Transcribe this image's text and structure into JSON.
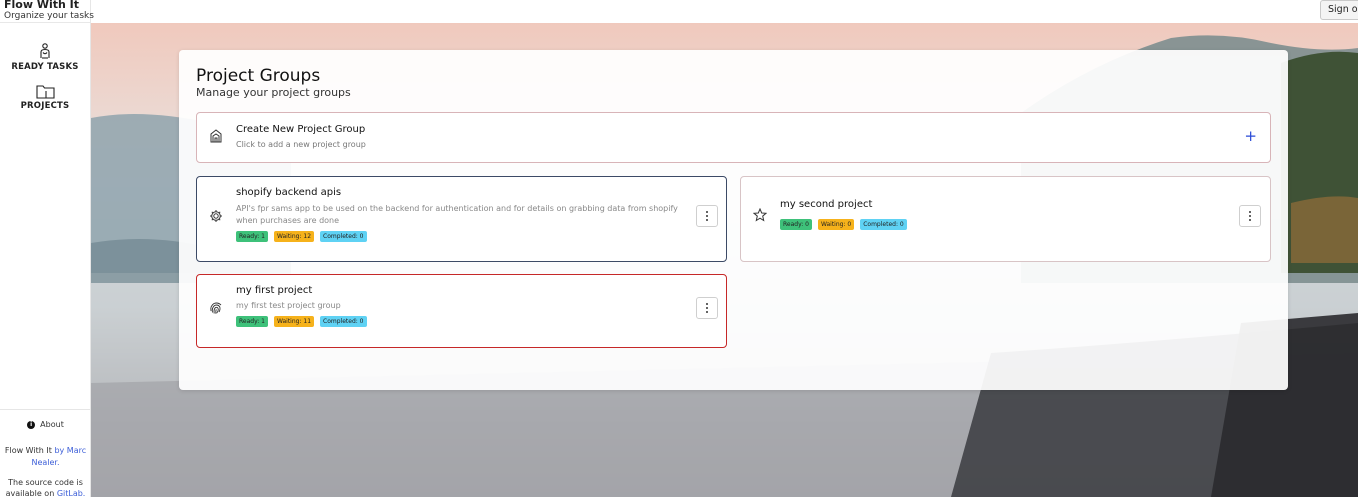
{
  "app": {
    "title": "Flow With It",
    "subtitle": "Organize your tasks"
  },
  "nav": [
    {
      "label": "READY TASKS",
      "icon": "person-raising-hand-icon"
    },
    {
      "label": "PROJECTS",
      "icon": "folder-icon"
    }
  ],
  "footer": {
    "about": "About",
    "credit_app": "Flow With It",
    "credit_by": "by",
    "credit_author": "Marc Nealer.",
    "source_text": "The source code is available on",
    "source_link": "GitLab."
  },
  "topbar": {
    "signout": "Sign out"
  },
  "page": {
    "title": "Project Groups",
    "subtitle": "Manage your project groups"
  },
  "create": {
    "title": "Create New Project Group",
    "subtitle": "Click to add a new project group",
    "plus": "+"
  },
  "projects": [
    {
      "title": "shopify backend apis",
      "description": "API's fpr sams app to be used on the backend for authentication and for details on grabbing data from shopify when purchases are done",
      "ready": "Ready: 1",
      "waiting": "Waiting: 12",
      "completed": "Completed: 0",
      "icon": "gear-icon",
      "border_color": "#3c4a66"
    },
    {
      "title": "my second project",
      "description": "",
      "ready": "Ready: 0",
      "waiting": "Waiting: 0",
      "completed": "Completed: 0",
      "icon": "star-icon",
      "border_color": "#d8c4c6"
    },
    {
      "title": "my first project",
      "description": "my first test project group",
      "ready": "Ready: 1",
      "waiting": "Waiting: 11",
      "completed": "Completed: 0",
      "icon": "fingerprint-icon",
      "border_color": "#c62828"
    }
  ],
  "colors": {
    "accent": "#2a4bd7",
    "ready": "#3ec17a",
    "waiting": "#f6b21b",
    "completed": "#5fd2f4"
  }
}
